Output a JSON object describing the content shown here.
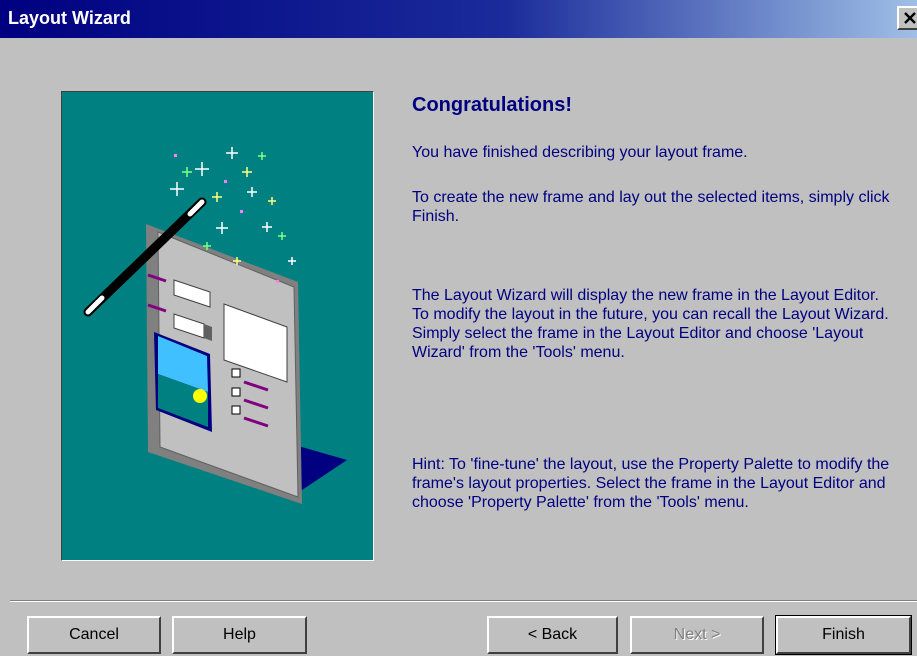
{
  "window": {
    "title": "Layout Wizard",
    "close_glyph": "close-icon"
  },
  "content": {
    "heading": "Congratulations!",
    "paragraphs": [
      "You have finished describing your layout frame.",
      "To create the new frame and lay out the selected items, simply click Finish.",
      "The Layout Wizard will display the new frame in the Layout Editor. To modify the layout in the future, you can recall the Layout Wizard. Simply select the frame in the Layout Editor and choose 'Layout Wizard' from the 'Tools' menu.",
      "Hint: To 'fine-tune' the layout, use the Property Palette to modify the frame's layout properties. Select the frame in the Layout Editor and choose 'Property Palette' from the 'Tools' menu."
    ]
  },
  "buttons": {
    "cancel": "Cancel",
    "help": "Help",
    "back": "< Back",
    "next": "Next >",
    "finish": "Finish"
  },
  "colors": {
    "title_bar": "#000080",
    "text": "#000080",
    "art_background": "#008080",
    "dialog_background": "#c0c0c0"
  }
}
